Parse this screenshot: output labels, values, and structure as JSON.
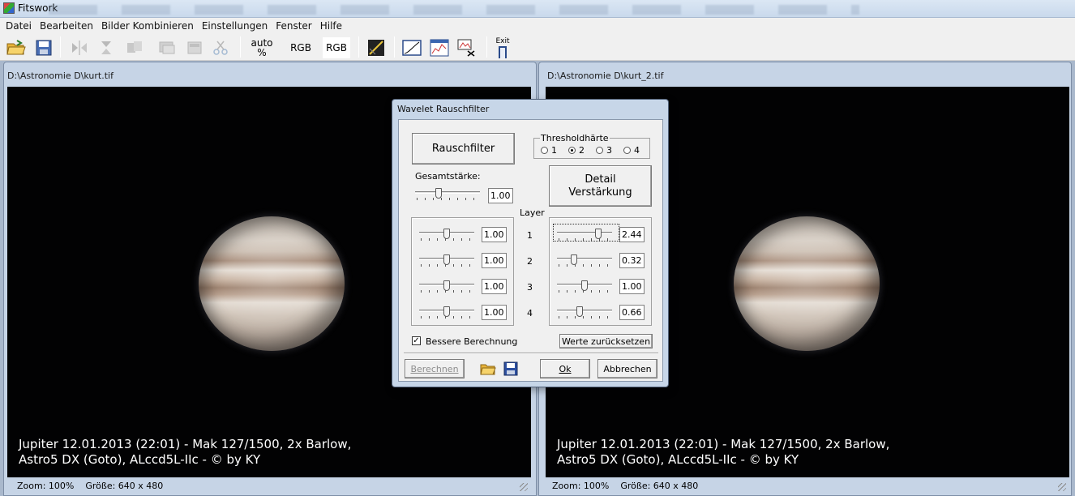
{
  "app": {
    "title": "Fitswork"
  },
  "menu": [
    "Datei",
    "Bearbeiten",
    "Bilder Kombinieren",
    "Einstellungen",
    "Fenster",
    "Hilfe"
  ],
  "toolbar": {
    "auto_line1": "auto",
    "auto_line2": "%",
    "rgb1": "RGB",
    "rgb2": "RGB",
    "exit": "Exit"
  },
  "windows": [
    {
      "path": "D:\\Astronomie D\\kurt.tif",
      "caption_line1": "Jupiter 12.01.2013 (22:01) - Mak 127/1500, 2x Barlow,",
      "caption_line2": "Astro5 DX (Goto), ALccd5L-IIc - © by KY",
      "zoom": "Zoom: 100%",
      "size": "Größe: 640 x 480"
    },
    {
      "path": "D:\\Astronomie D\\kurt_2.tif",
      "caption_line1": "Jupiter 12.01.2013 (22:01) - Mak 127/1500, 2x Barlow,",
      "caption_line2": "Astro5 DX (Goto), ALccd5L-IIc - © by KY",
      "zoom": "Zoom: 100%",
      "size": "Größe: 640 x 480"
    }
  ],
  "dialog": {
    "title": "Wavelet Rauschfilter",
    "rauschfilter_label": "Rauschfilter",
    "threshold": {
      "label": "Thresholdhärte",
      "options": [
        "1",
        "2",
        "3",
        "4"
      ],
      "selected": "2"
    },
    "gesamt": {
      "label": "Gesamtstärke:",
      "value": "1.00",
      "level": 0.35
    },
    "detail_line1": "Detail",
    "detail_line2": "Verstärkung",
    "layer_label": "Layer",
    "layers": [
      "1",
      "2",
      "3",
      "4"
    ],
    "noise_values": [
      {
        "value": "1.00",
        "level": 0.5
      },
      {
        "value": "1.00",
        "level": 0.5
      },
      {
        "value": "1.00",
        "level": 0.5
      },
      {
        "value": "1.00",
        "level": 0.5
      }
    ],
    "detail_values": [
      {
        "value": "2.44",
        "level": 0.78
      },
      {
        "value": "0.32",
        "level": 0.28
      },
      {
        "value": "1.00",
        "level": 0.5
      },
      {
        "value": "0.66",
        "level": 0.4
      }
    ],
    "better_calc_label": "Bessere Berechnung",
    "better_calc_checked": true,
    "reset_label": "Werte zurücksetzen",
    "compute_label": "Berechnen",
    "ok_label": "Ok",
    "cancel_label": "Abbrechen"
  }
}
